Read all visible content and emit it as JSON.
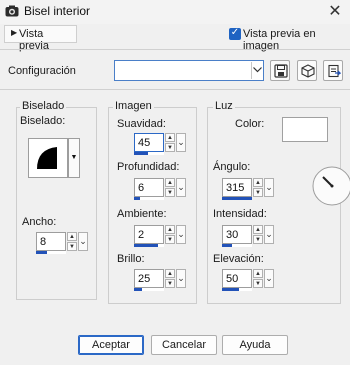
{
  "window": {
    "title": "Bisel interior",
    "close_glyph": "✕"
  },
  "preview": {
    "toggle_label": "Vista previa",
    "checkbox_label": "Vista previa en imagen",
    "checkbox_checked": true
  },
  "config": {
    "label": "Configuración",
    "value": ""
  },
  "biselado": {
    "group_title": "Biselado",
    "bevel_label": "Biselado:",
    "width_label": "Ancho:",
    "width_value": "8"
  },
  "imagen": {
    "group_title": "Imagen",
    "fields": [
      {
        "label": "Suavidad:",
        "value": "45"
      },
      {
        "label": "Profundidad:",
        "value": "6"
      },
      {
        "label": "Ambiente:",
        "value": "2"
      },
      {
        "label": "Brillo:",
        "value": "25"
      }
    ]
  },
  "luz": {
    "group_title": "Luz",
    "color_label": "Color:",
    "color_value": "#ffffff",
    "fields": [
      {
        "label": "Ángulo:",
        "value": "315"
      },
      {
        "label": "Intensidad:",
        "value": "30"
      },
      {
        "label": "Elevación:",
        "value": "50"
      }
    ]
  },
  "buttons": {
    "ok": "Aceptar",
    "cancel": "Cancelar",
    "help": "Ayuda"
  },
  "colors": {
    "accent": "#1f63c2",
    "slider": "#2252b8"
  },
  "icons": [
    "app-icon",
    "save-icon",
    "cube-icon",
    "reset-icon",
    "angle-dial-icon"
  ]
}
